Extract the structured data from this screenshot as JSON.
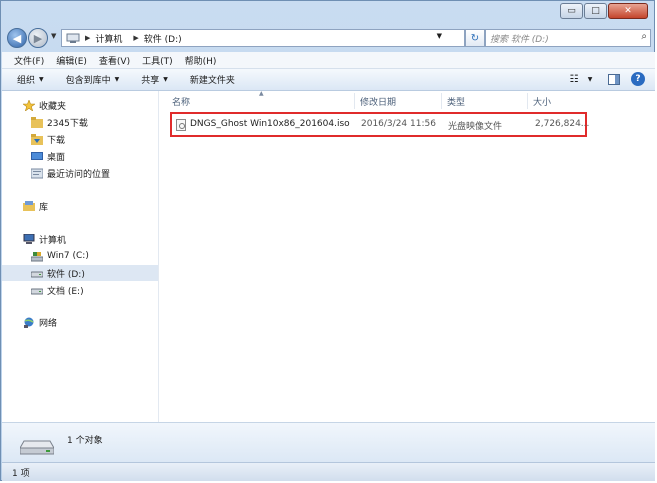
{
  "window": {
    "buttons": {
      "minimize": "▭",
      "maximize": "□",
      "close": "✕"
    }
  },
  "address": {
    "segments": [
      "计算机",
      "软件 (D:)"
    ],
    "search_placeholder": "搜索 软件 (D:)"
  },
  "menu": [
    "文件(F)",
    "编辑(E)",
    "查看(V)",
    "工具(T)",
    "帮助(H)"
  ],
  "toolbar": {
    "organize": "组织",
    "include_library": "包含到库中",
    "share": "共享",
    "new_folder": "新建文件夹"
  },
  "nav": {
    "favorites": "收藏夹",
    "fav_items": [
      "2345下载",
      "下载",
      "桌面",
      "最近访问的位置"
    ],
    "libraries": "库",
    "computer": "计算机",
    "drives": [
      "Win7 (C:)",
      "软件 (D:)",
      "文档 (E:)"
    ],
    "network": "网络"
  },
  "columns": {
    "name": "名称",
    "modified": "修改日期",
    "type": "类型",
    "size": "大小"
  },
  "files": [
    {
      "name": "DNGS_Ghost Win10x86_201604.iso",
      "modified": "2016/3/24 11:56",
      "type": "光盘映像文件",
      "size": "2,726,824..."
    }
  ],
  "details": {
    "count": "1 个对象"
  },
  "status": {
    "text": "1 项"
  },
  "colors": {
    "highlight_border": "#e02b2b",
    "selection": "#dde7f3",
    "accent": "#2a6bc1"
  },
  "icons": [
    "back-icon",
    "forward-icon",
    "refresh-icon",
    "search-icon",
    "view-icon",
    "preview-pane-icon",
    "help-icon",
    "star-icon",
    "folder-icon",
    "desktop-icon",
    "recent-icon",
    "library-icon",
    "computer-icon",
    "drive-icon",
    "network-icon",
    "disc-image-icon"
  ]
}
